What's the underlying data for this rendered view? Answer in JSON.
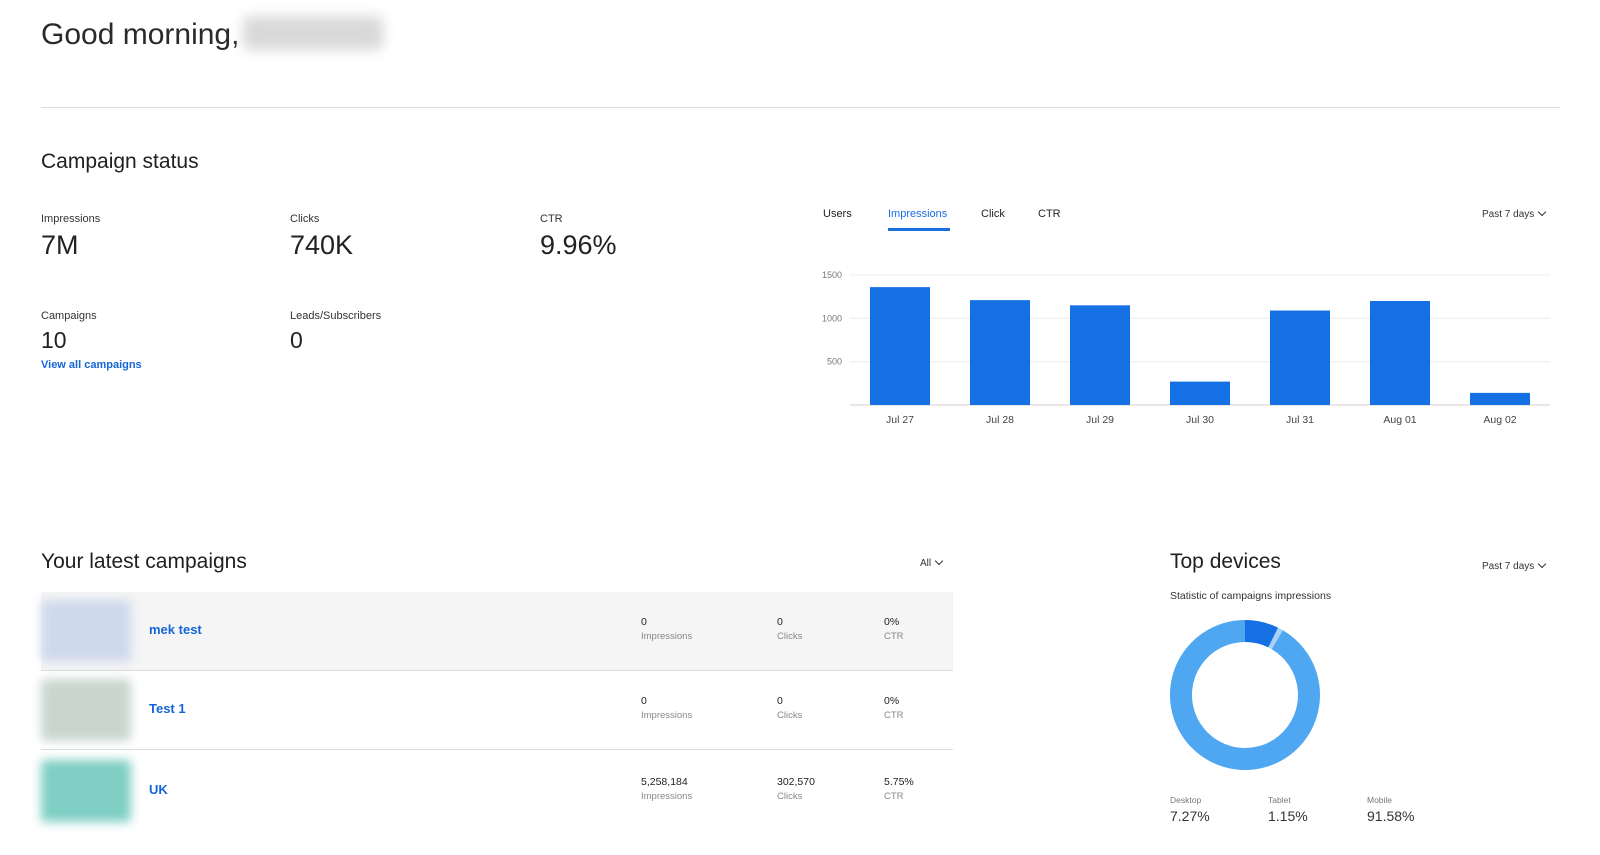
{
  "greeting": {
    "text": "Good morning,"
  },
  "campaign_status": {
    "title": "Campaign status",
    "stats": [
      {
        "label": "Impressions",
        "value": "7M"
      },
      {
        "label": "Clicks",
        "value": "740K"
      },
      {
        "label": "CTR",
        "value": "9.96%"
      },
      {
        "label": "Campaigns",
        "value": "10"
      },
      {
        "label": "Leads/Subscribers",
        "value": "0"
      }
    ],
    "view_all_link": "View all campaigns"
  },
  "chart_tabs": [
    "Users",
    "Impressions",
    "Click",
    "CTR"
  ],
  "active_tab": "Impressions",
  "chart_period": "Past 7 days",
  "chart_data": {
    "type": "bar",
    "categories": [
      "Jul 27",
      "Jul 28",
      "Jul 29",
      "Jul 30",
      "Jul 31",
      "Aug 01",
      "Aug 02"
    ],
    "values": [
      1360,
      1210,
      1150,
      270,
      1090,
      1200,
      140
    ],
    "yticks": [
      500,
      1000,
      1500
    ],
    "ylim": [
      0,
      1500
    ],
    "grid": true,
    "bar_color": "#1470e3"
  },
  "latest_campaigns": {
    "title": "Your latest campaigns",
    "filter": "All",
    "rows": [
      {
        "name": "mek test",
        "impressions": "0",
        "clicks": "0",
        "ctr": "0%",
        "thumb_color": "#cfd9ec"
      },
      {
        "name": "Test 1",
        "impressions": "0",
        "clicks": "0",
        "ctr": "0%",
        "thumb_color": "#c9d6cf"
      },
      {
        "name": "UK",
        "impressions": "5,258,184",
        "clicks": "302,570",
        "ctr": "5.75%",
        "thumb_color": "#7fcfc4"
      }
    ],
    "metric_labels": {
      "impressions": "Impressions",
      "clicks": "Clicks",
      "ctr": "CTR"
    }
  },
  "top_devices": {
    "title": "Top devices",
    "subtitle": "Statistic of campaigns impressions",
    "period": "Past 7 days",
    "devices": [
      {
        "label": "Desktop",
        "value": "7.27%",
        "pct": 7.27,
        "color": "#1470e3"
      },
      {
        "label": "Tablet",
        "value": "1.15%",
        "pct": 1.15,
        "color": "#a9d0f5"
      },
      {
        "label": "Mobile",
        "value": "91.58%",
        "pct": 91.58,
        "color": "#4ea7f0"
      }
    ]
  }
}
